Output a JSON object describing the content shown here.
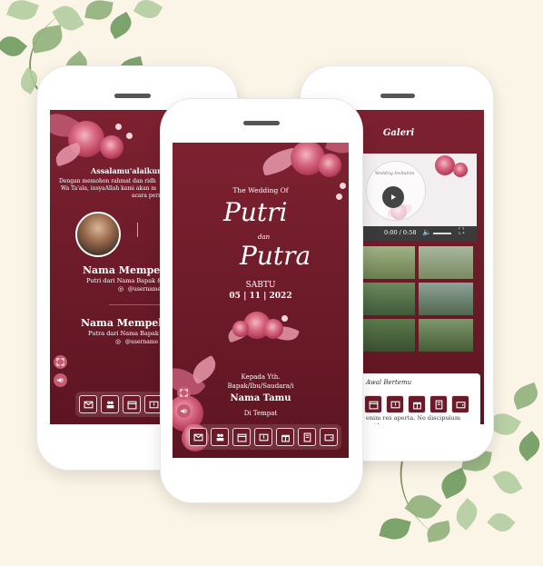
{
  "accent": "#6e1d2b",
  "left_phone": {
    "greeting": "Assalamu'alaikum W",
    "intro_line1": "Dengan memohon rahmat dan ridh",
    "intro_line2": "Wa Ta'ala, insyaAllah kami akan m",
    "intro_line3": "acara pernikahan",
    "bride_heading": "Nama Mempela",
    "bride_parents": "Putri dari Nama Bapak &",
    "bride_handle": "@username",
    "groom_heading": "Nama Mempela",
    "groom_parents": "Putra dari Nama Bapak &",
    "groom_handle": "@username"
  },
  "center_phone": {
    "subtitle": "The Wedding Of",
    "bride_name": "Putri",
    "conjunction": "dan",
    "groom_name": "Putra",
    "day": "SABTU",
    "date": "05 | 11 | 2022",
    "to_label": "Kepada Yth.",
    "recipient_title": "Bapak/Ibu/Saudara/i",
    "guest_name": "Nama Tamu",
    "place": "Di Tempat"
  },
  "right_phone": {
    "title": "Galeri",
    "video_caption_small": "Wedding Invitation",
    "player_time": "0:00 / 0:58",
    "story_heading": "Awal Bertemu",
    "story_line1": "enim res aperta. Ne discipulum",
    "story_line2": "quidem"
  },
  "icons": [
    "envelope-icon",
    "couple-icon",
    "calendar-icon",
    "map-icon",
    "gift-icon",
    "book-icon",
    "wallet-icon"
  ]
}
